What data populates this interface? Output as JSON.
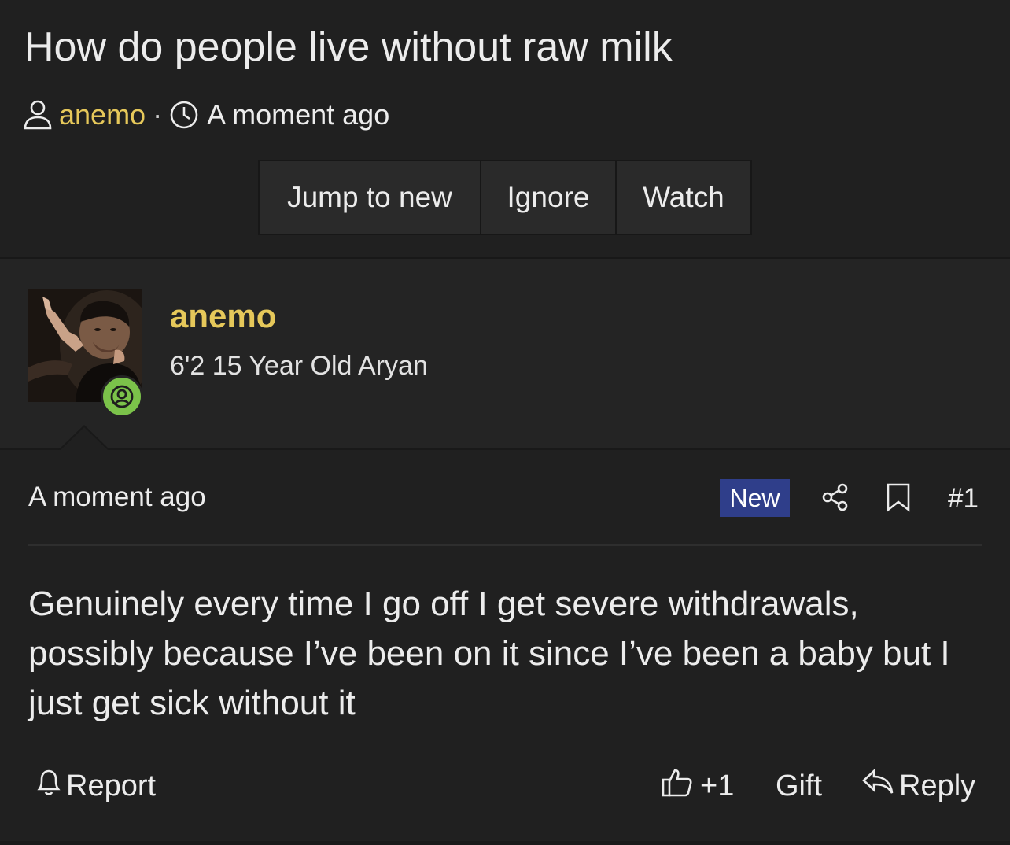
{
  "thread": {
    "title": "How do people live without raw milk",
    "author": "anemo",
    "separator": "·",
    "time": "A moment ago"
  },
  "actions": {
    "jump_to_new": "Jump to new",
    "ignore": "Ignore",
    "watch": "Watch"
  },
  "post": {
    "username": "anemo",
    "user_title": "6'2 15 Year Old Aryan",
    "time": "A moment ago",
    "badge": "New",
    "number": "#1",
    "body": "Genuinely every time I go off I get severe withdrawals, possibly because I’ve been on it since I’ve been a baby but I just get sick without it"
  },
  "footer": {
    "report": "Report",
    "like": "+1",
    "gift": "Gift",
    "reply": "Reply"
  },
  "icons": {
    "author": "user-icon",
    "time": "clock-icon",
    "online": "online-status-icon",
    "share": "share-icon",
    "bookmark": "bookmark-icon",
    "report": "bell-icon",
    "like": "thumbs-up-icon",
    "reply": "reply-icon"
  },
  "colors": {
    "background": "#202020",
    "username": "#e6c85a",
    "new_badge": "#2f3e8a",
    "online": "#7bc24a"
  }
}
